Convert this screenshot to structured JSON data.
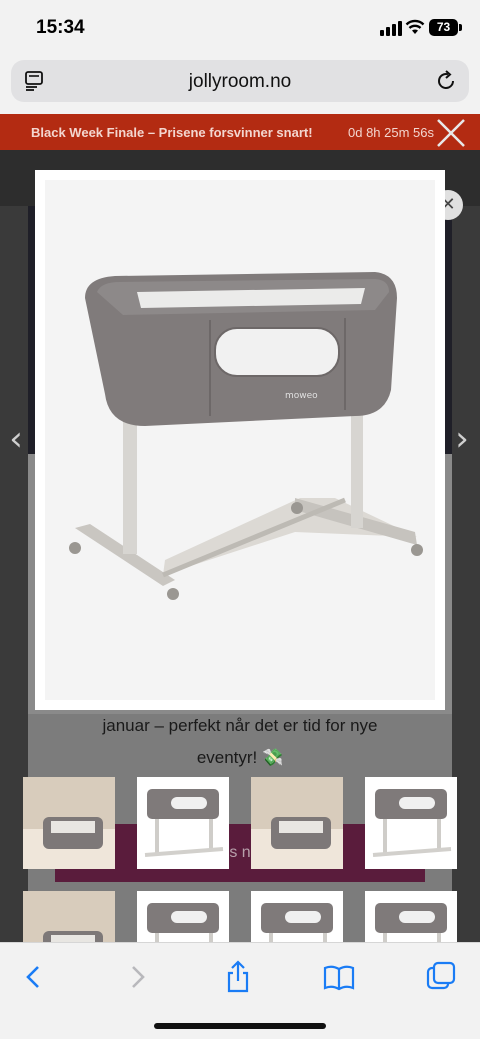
{
  "status_bar": {
    "time": "15:34",
    "battery": "73"
  },
  "url_bar": {
    "domain": "jollyroom.no"
  },
  "promo": {
    "text": "Black Week Finale – Prisene forsvinner snart!",
    "timer": "0d 8h 25m 56s"
  },
  "product": {
    "brand_mark": "moweo"
  },
  "description": {
    "line1": "januar – perfekt når det er tid for nye",
    "line2": "eventyr! 💸"
  },
  "buy_button": {
    "label": "s n"
  },
  "thumbnails": [
    {
      "kind": "lifestyle"
    },
    {
      "kind": "product"
    },
    {
      "kind": "lifestyle"
    },
    {
      "kind": "product"
    },
    {
      "kind": "lifestyle"
    },
    {
      "kind": "product"
    },
    {
      "kind": "product"
    },
    {
      "kind": "product"
    }
  ],
  "icons": [
    "reader-icon",
    "reload-icon",
    "close-icon",
    "chevron-left-icon",
    "chevron-right-icon",
    "back-icon",
    "forward-icon",
    "share-icon",
    "bookmarks-icon",
    "tabs-icon"
  ],
  "colors": {
    "promo_bg": "#b32b12",
    "safari_blue": "#1a7cf5",
    "buy_button": "#5a1c3c"
  }
}
